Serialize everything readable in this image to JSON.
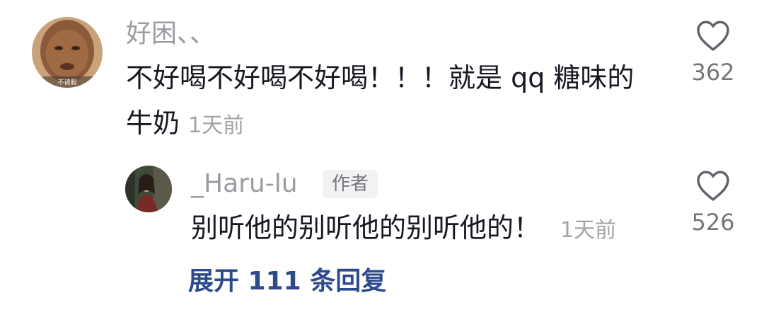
{
  "comment": {
    "username": "好困、、",
    "text_line1": "不好喝不好喝不好喝！！！就是 qq 糖味的",
    "text_line2": "牛奶",
    "time": "1天前",
    "like_count": "362",
    "avatar_caption": "不请假"
  },
  "reply": {
    "username": "_Haru-lu",
    "badge": "作者",
    "text": "别听他的别听他的别听他的！",
    "time": "1天前",
    "like_count": "526"
  },
  "expand_replies_label": "展开 111 条回复",
  "icons": {
    "like": "heart-outline-icon"
  },
  "colors": {
    "text_primary": "#161823",
    "text_secondary": "#9b9ba2",
    "link": "#2c4a8c",
    "badge_bg": "#f2f2f4"
  }
}
